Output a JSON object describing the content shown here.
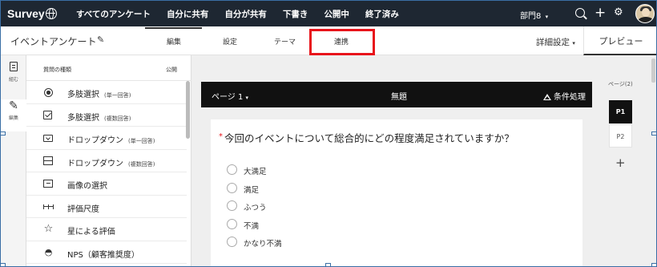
{
  "topnav": {
    "logo": "Survey",
    "items": [
      "すべてのアンケート",
      "自分に共有",
      "自分が共有",
      "下書き",
      "公開中",
      "終了済み"
    ],
    "department": "部門8",
    "dept_caret": "▾"
  },
  "subbar": {
    "survey_title": "イベントアンケート",
    "tabs": [
      "編集",
      "設定",
      "テーマ",
      "連携"
    ],
    "advanced": "詳細設定",
    "preview": "プレビュー"
  },
  "rail": {
    "org_label": "組む",
    "edit_label": "編集"
  },
  "qpanel": {
    "title": "質問の種類",
    "public": "公開",
    "items": [
      {
        "icon": "radio-icon",
        "label": "多肢選択",
        "sub": "(単一回答)"
      },
      {
        "icon": "checkbox-icon",
        "label": "多肢選択",
        "sub": "(複数回答)"
      },
      {
        "icon": "dropdown-icon",
        "label": "ドロップダウン",
        "sub": "(単一回答)"
      },
      {
        "icon": "dropdown-multi-icon",
        "label": "ドロップダウン",
        "sub": "(複数回答)"
      },
      {
        "icon": "image-choice-icon",
        "label": "画像の選択",
        "sub": ""
      },
      {
        "icon": "rating-scale-icon",
        "label": "評価尺度",
        "sub": ""
      },
      {
        "icon": "star-icon",
        "label": "星による評価",
        "sub": ""
      },
      {
        "icon": "nps-gauge-icon",
        "label": "NPS（顧客推奨度）",
        "sub": ""
      }
    ]
  },
  "page_header": {
    "page": "ページ 1",
    "title": "無題",
    "condition": "条件処理"
  },
  "question": {
    "required_mark": "*",
    "text": "今回のイベントについて総合的にどの程度満足されていますか？",
    "options": [
      "大満足",
      "満足",
      "ふつう",
      "不満",
      "かなり不満"
    ]
  },
  "pagenav": {
    "label": "ページ(2)",
    "pages": [
      "P1",
      "P2"
    ],
    "add": "+"
  },
  "colors": {
    "topnav_bg": "#1e2732",
    "highlight": "#e8141b",
    "page_header_bg": "#111111"
  }
}
